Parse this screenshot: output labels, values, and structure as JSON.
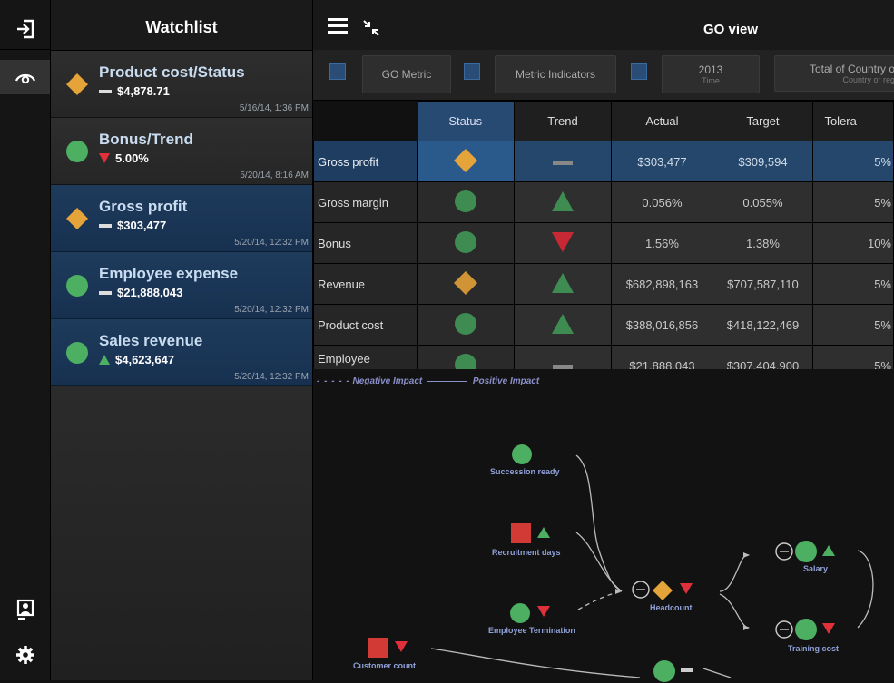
{
  "watchlist": {
    "title": "Watchlist",
    "items": [
      {
        "title": "Product cost/Status",
        "value": "$4,878.71",
        "date": "5/16/14, 1:36 PM",
        "status": "diamond",
        "trend": "flat",
        "selected": false
      },
      {
        "title": "Bonus/Trend",
        "value": "5.00%",
        "date": "5/20/14, 8:16 AM",
        "status": "circle",
        "trend": "down",
        "selected": false
      },
      {
        "title": "Gross profit",
        "value": "$303,477",
        "date": "5/20/14, 12:32 PM",
        "status": "diamond",
        "trend": "flat",
        "selected": true
      },
      {
        "title": "Employee expense",
        "value": "$21,888,043",
        "date": "5/20/14, 12:32 PM",
        "status": "circle",
        "trend": "flat",
        "selected": true
      },
      {
        "title": "Sales revenue",
        "value": "$4,623,647",
        "date": "5/20/14, 12:32 PM",
        "status": "circle",
        "trend": "up",
        "selected": true
      }
    ]
  },
  "rail": {
    "icons": [
      "sign-in-icon",
      "eye-icon",
      "user-card-icon",
      "gear-icon"
    ]
  },
  "topbar": {
    "title": "GO view"
  },
  "toolbar": {
    "metric_label": "GO Metric",
    "indicators_label": "Metric Indicators",
    "time_value": "2013",
    "time_label": "Time",
    "country_value": "Total of Country o",
    "country_label": "Country or reg"
  },
  "table": {
    "columns": [
      "Status",
      "Trend",
      "Actual",
      "Target",
      "Tolera"
    ],
    "rows": [
      {
        "label": "Gross profit",
        "status": "diamond",
        "trend": "flat",
        "actual": "$303,477",
        "target": "$309,594",
        "tolerance": "5%",
        "selected": true
      },
      {
        "label": "Gross margin",
        "status": "circle",
        "trend": "up",
        "actual": "0.056%",
        "target": "0.055%",
        "tolerance": "5%",
        "selected": false
      },
      {
        "label": "Bonus",
        "status": "circle",
        "trend": "down",
        "actual": "1.56%",
        "target": "1.38%",
        "tolerance": "10%",
        "selected": false
      },
      {
        "label": "Revenue",
        "status": "diamond",
        "trend": "up",
        "actual": "$682,898,163",
        "target": "$707,587,110",
        "tolerance": "5%",
        "selected": false
      },
      {
        "label": "Product cost",
        "status": "circle",
        "trend": "up",
        "actual": "$388,016,856",
        "target": "$418,122,469",
        "tolerance": "5%",
        "selected": false
      },
      {
        "label": "Employee expense",
        "status": "circle",
        "trend": "flat",
        "actual": "$21,888,043",
        "target": "$307,404,900",
        "tolerance": "5%",
        "selected": false
      }
    ]
  },
  "diagram": {
    "legend_negative": "Negative Impact",
    "legend_positive": "Positive Impact",
    "nodes": [
      {
        "label": "Succession ready"
      },
      {
        "label": "Recruitment days"
      },
      {
        "label": "Employee Termination"
      },
      {
        "label": "Headcount"
      },
      {
        "label": "Salary"
      },
      {
        "label": "Training cost"
      },
      {
        "label": "Customer count"
      }
    ]
  },
  "colors": {
    "accent_blue": "#274a72",
    "status_green": "#4caf62",
    "status_diamond": "#e5a43a",
    "trend_up": "#4caf62",
    "trend_down": "#e0303a",
    "square_red": "#d13a35"
  }
}
